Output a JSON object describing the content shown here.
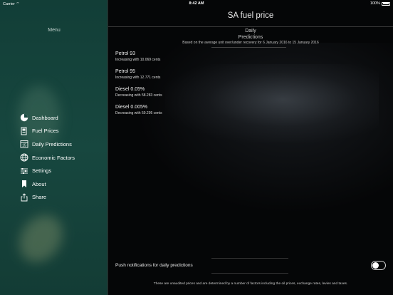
{
  "status_bar": {
    "carrier": "Carrier",
    "time": "8:42 AM",
    "battery": "100%"
  },
  "sidebar": {
    "title": "Menu",
    "items": [
      {
        "label": "Dashboard",
        "icon": "pie-chart-icon"
      },
      {
        "label": "Fuel Prices",
        "icon": "fuel-pump-icon"
      },
      {
        "label": "Daily Predictions",
        "icon": "calendar-icon",
        "icon_text": "15"
      },
      {
        "label": "Economic Factors",
        "icon": "globe-icon"
      },
      {
        "label": "Settings",
        "icon": "sliders-icon"
      },
      {
        "label": "About",
        "icon": "bookmark-icon"
      },
      {
        "label": "Share",
        "icon": "share-icon"
      }
    ]
  },
  "main": {
    "title": "SA fuel price",
    "section_line1": "Daily",
    "section_line2": "Predictions",
    "basis_text": "Based on the average unit over/under recovery for 6 January 2016 to 15 January 2016",
    "fuels": [
      {
        "name": "Petrol 93",
        "detail": "Increasing with 10.069 cents"
      },
      {
        "name": "Petrol 95",
        "detail": "Increasing with 12.771 cents"
      },
      {
        "name": "Diesel 0.05%",
        "detail": "Decreasing with 58.283 cents"
      },
      {
        "name": "Diesel 0.005%",
        "detail": "Decreasing with 59.295 cents"
      }
    ],
    "push_label": "Push notifications for daily predictions",
    "push_enabled": false,
    "footer": "These are unaudited prices and are determined by a number of factors including the oil prices, exchange rates, levies and taxes."
  }
}
